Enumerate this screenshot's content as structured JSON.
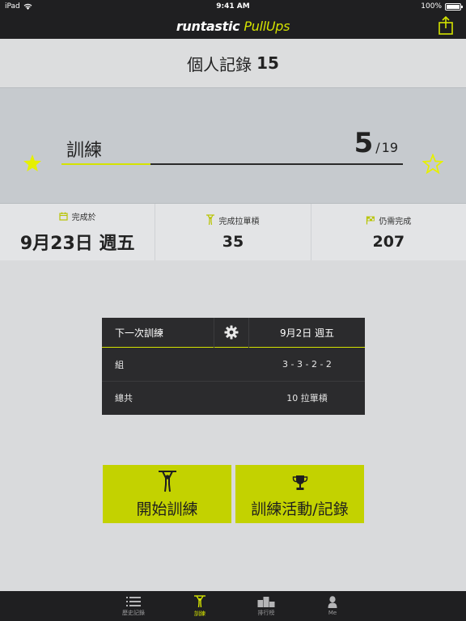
{
  "status_bar": {
    "device": "iPad",
    "time": "9:41 AM",
    "battery": "100%"
  },
  "nav": {
    "brand": "runtastic",
    "brand_accent": "PullUps"
  },
  "record": {
    "label": "個人記錄",
    "value": "15"
  },
  "level": {
    "label": "訓練",
    "current": "5",
    "separator": "/",
    "total": "19",
    "progress_fraction": 0.26
  },
  "stats": [
    {
      "icon": "calendar-icon",
      "title": "完成於",
      "value": "9月23日 週五"
    },
    {
      "icon": "pullup-figure-icon",
      "title": "完成拉單槓",
      "value": "35"
    },
    {
      "icon": "flag-icon",
      "title": "仍需完成",
      "value": "207"
    }
  ],
  "next_workout": {
    "title": "下一次訓練",
    "date": "9月2日 週五",
    "rows": [
      {
        "label": "組",
        "value": "3 - 3 - 2 - 2"
      },
      {
        "label": "總共",
        "value": "10 拉單槓"
      }
    ]
  },
  "buttons": {
    "start": "開始訓練",
    "log": "訓練活動/記錄"
  },
  "tabs": [
    {
      "icon": "list-icon",
      "label": "歷史記錄",
      "active": false
    },
    {
      "icon": "pullup-figure-icon",
      "label": "訓練",
      "active": true
    },
    {
      "icon": "podium-icon",
      "label": "排行榜",
      "active": false
    },
    {
      "icon": "person-icon",
      "label": "Me",
      "active": false
    }
  ],
  "colors": {
    "accent": "#d4e300",
    "button": "#c3d200",
    "dark": "#1f1f21",
    "card": "#2b2b2d"
  }
}
